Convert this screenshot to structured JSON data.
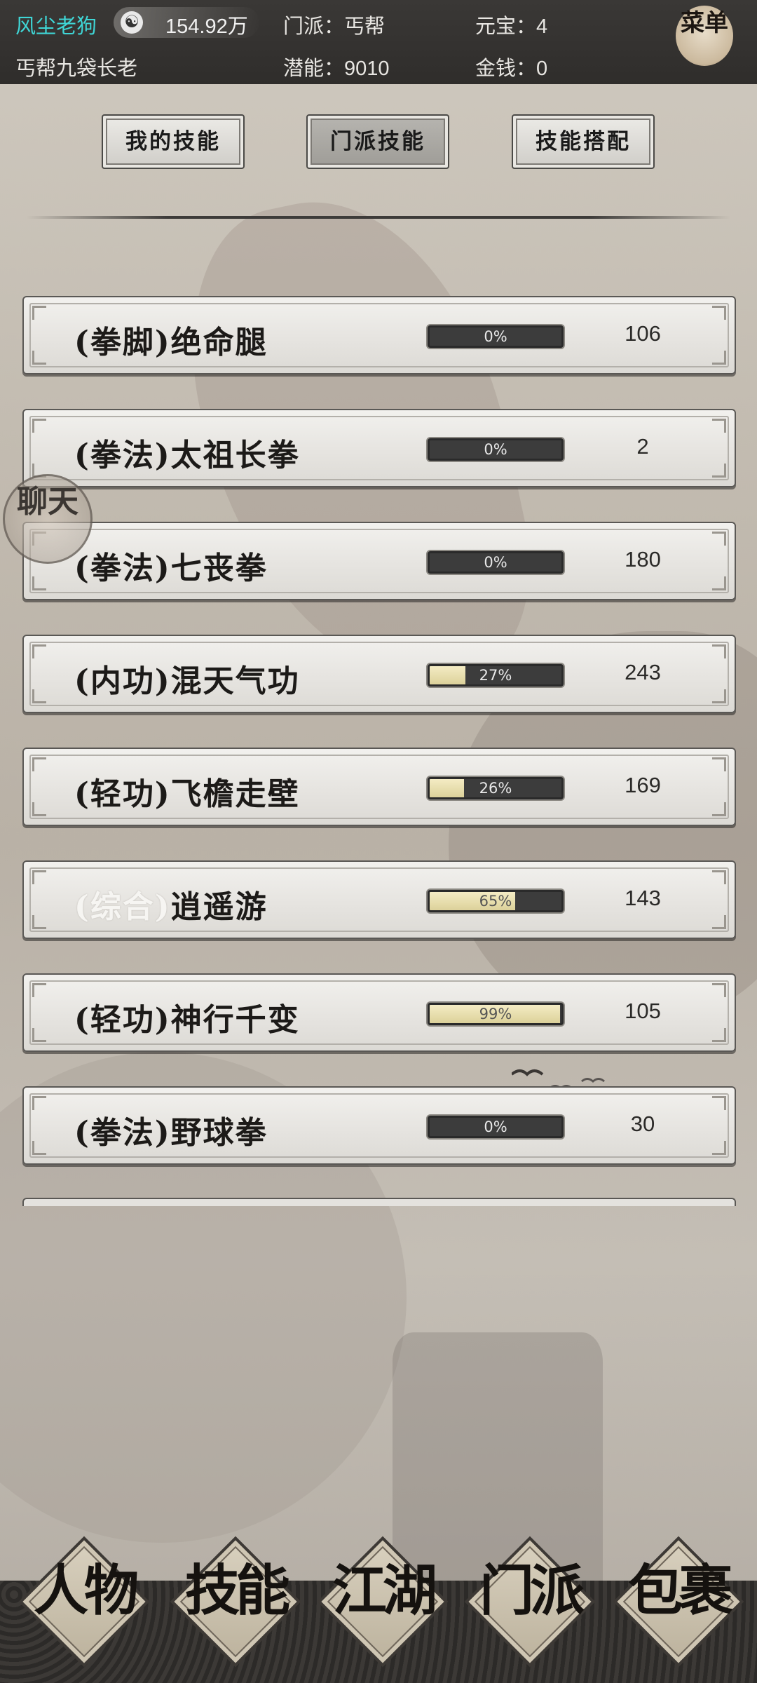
{
  "header": {
    "player_name": "风尘老狗",
    "silver_icon": "yin-yang-icon",
    "silver_value": "154.92万",
    "sect": "门派：丐帮",
    "yuanbao": "元宝：4",
    "title": "丐帮九袋长老",
    "potential": "潜能：9010",
    "money": "金钱：0",
    "menu_label": "菜单"
  },
  "tabs": [
    {
      "label": "我的技能",
      "selected": false
    },
    {
      "label": "门派技能",
      "selected": true
    },
    {
      "label": "技能搭配",
      "selected": false
    }
  ],
  "chat_label": "聊天",
  "skills": [
    {
      "category": "(拳脚)",
      "name": "绝命腿",
      "progress": 0,
      "progress_label": "0%",
      "level": "106"
    },
    {
      "category": "(拳法)",
      "name": "太祖长拳",
      "progress": 0,
      "progress_label": "0%",
      "level": "2"
    },
    {
      "category": "(拳法)",
      "name": "七丧拳",
      "progress": 0,
      "progress_label": "0%",
      "level": "180"
    },
    {
      "category": "(内功)",
      "name": "混天气功",
      "progress": 27,
      "progress_label": "27%",
      "level": "243"
    },
    {
      "category": "(轻功)",
      "name": "飞檐走壁",
      "progress": 26,
      "progress_label": "26%",
      "level": "169"
    },
    {
      "category": "(综合)",
      "name": "逍遥游",
      "progress": 65,
      "progress_label": "65%",
      "level": "143"
    },
    {
      "category": "(轻功)",
      "name": "神行千变",
      "progress": 99,
      "progress_label": "99%",
      "level": "105"
    },
    {
      "category": "(拳法)",
      "name": "野球拳",
      "progress": 0,
      "progress_label": "0%",
      "level": "30"
    }
  ],
  "bottom_nav": [
    {
      "label": "人物",
      "icon": "character-icon"
    },
    {
      "label": "技能",
      "icon": "skills-icon"
    },
    {
      "label": "江湖",
      "icon": "world-icon"
    },
    {
      "label": "门派",
      "icon": "sect-icon"
    },
    {
      "label": "包裹",
      "icon": "bag-icon"
    }
  ],
  "colors": {
    "player_name": "#3fd6d6",
    "header_bg": "#2f2d2b",
    "progress_fill": "#e8e0b0",
    "progress_track": "#3c3c3c"
  }
}
